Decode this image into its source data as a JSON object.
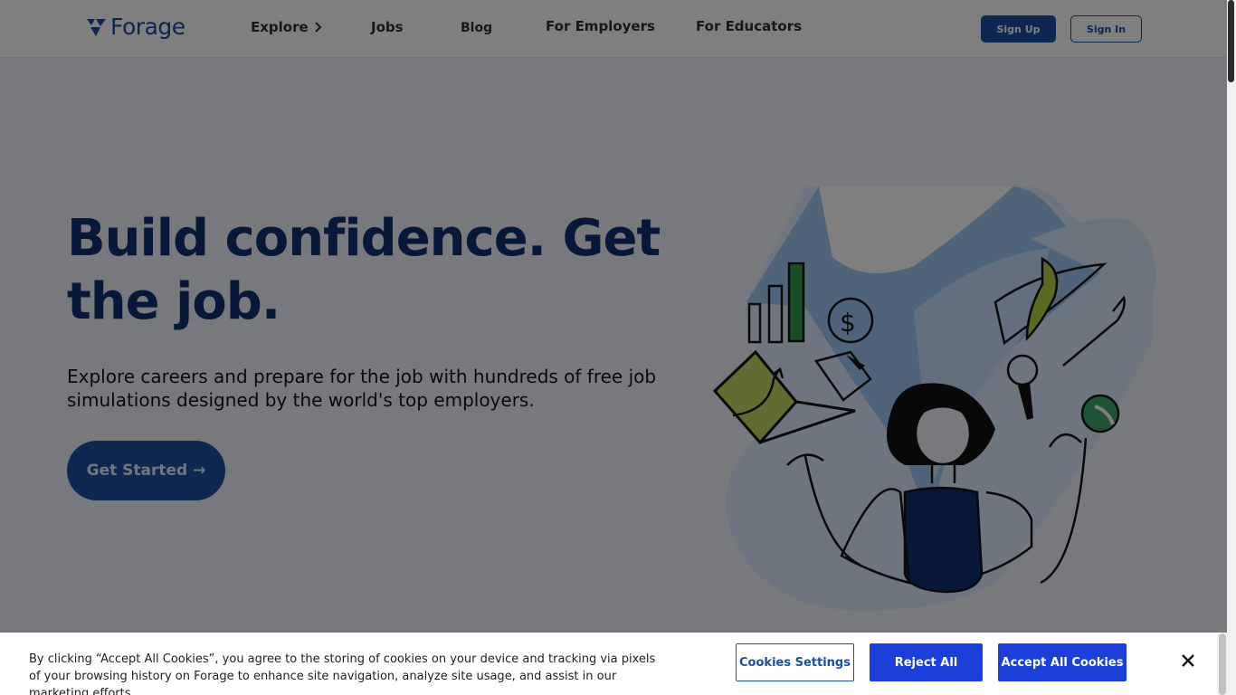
{
  "header": {
    "logo_text": "Forage",
    "nav": {
      "explore": "Explore",
      "jobs": "Jobs",
      "blog": "Blog",
      "employers": "For Employers",
      "educators": "For Educators"
    },
    "signup_label": "Sign Up",
    "signin_label": "Sign In"
  },
  "hero": {
    "title": "Build confidence. Get the job.",
    "subtitle": "Explore careers and prepare for the job with hundreds of free job simulations designed by the world's top employers.",
    "cta_label": "Get Started →"
  },
  "cookie_banner": {
    "text": "By clicking “Accept All Cookies”, you agree to the storing of cookies on your device and tracking via pixels of your browsing history on Forage to enhance site navigation, analyze site usage, and assist in our marketing efforts.",
    "settings_label": "Cookies Settings",
    "reject_label": "Reject All",
    "accept_label": "Accept All Cookies"
  },
  "colors": {
    "brand": "#1a4fa3",
    "title": "#0d2f6e",
    "cookie_button": "#1b3fd8"
  },
  "icons": [
    "forage-logo-icon",
    "chevron-right-icon",
    "close-icon"
  ]
}
